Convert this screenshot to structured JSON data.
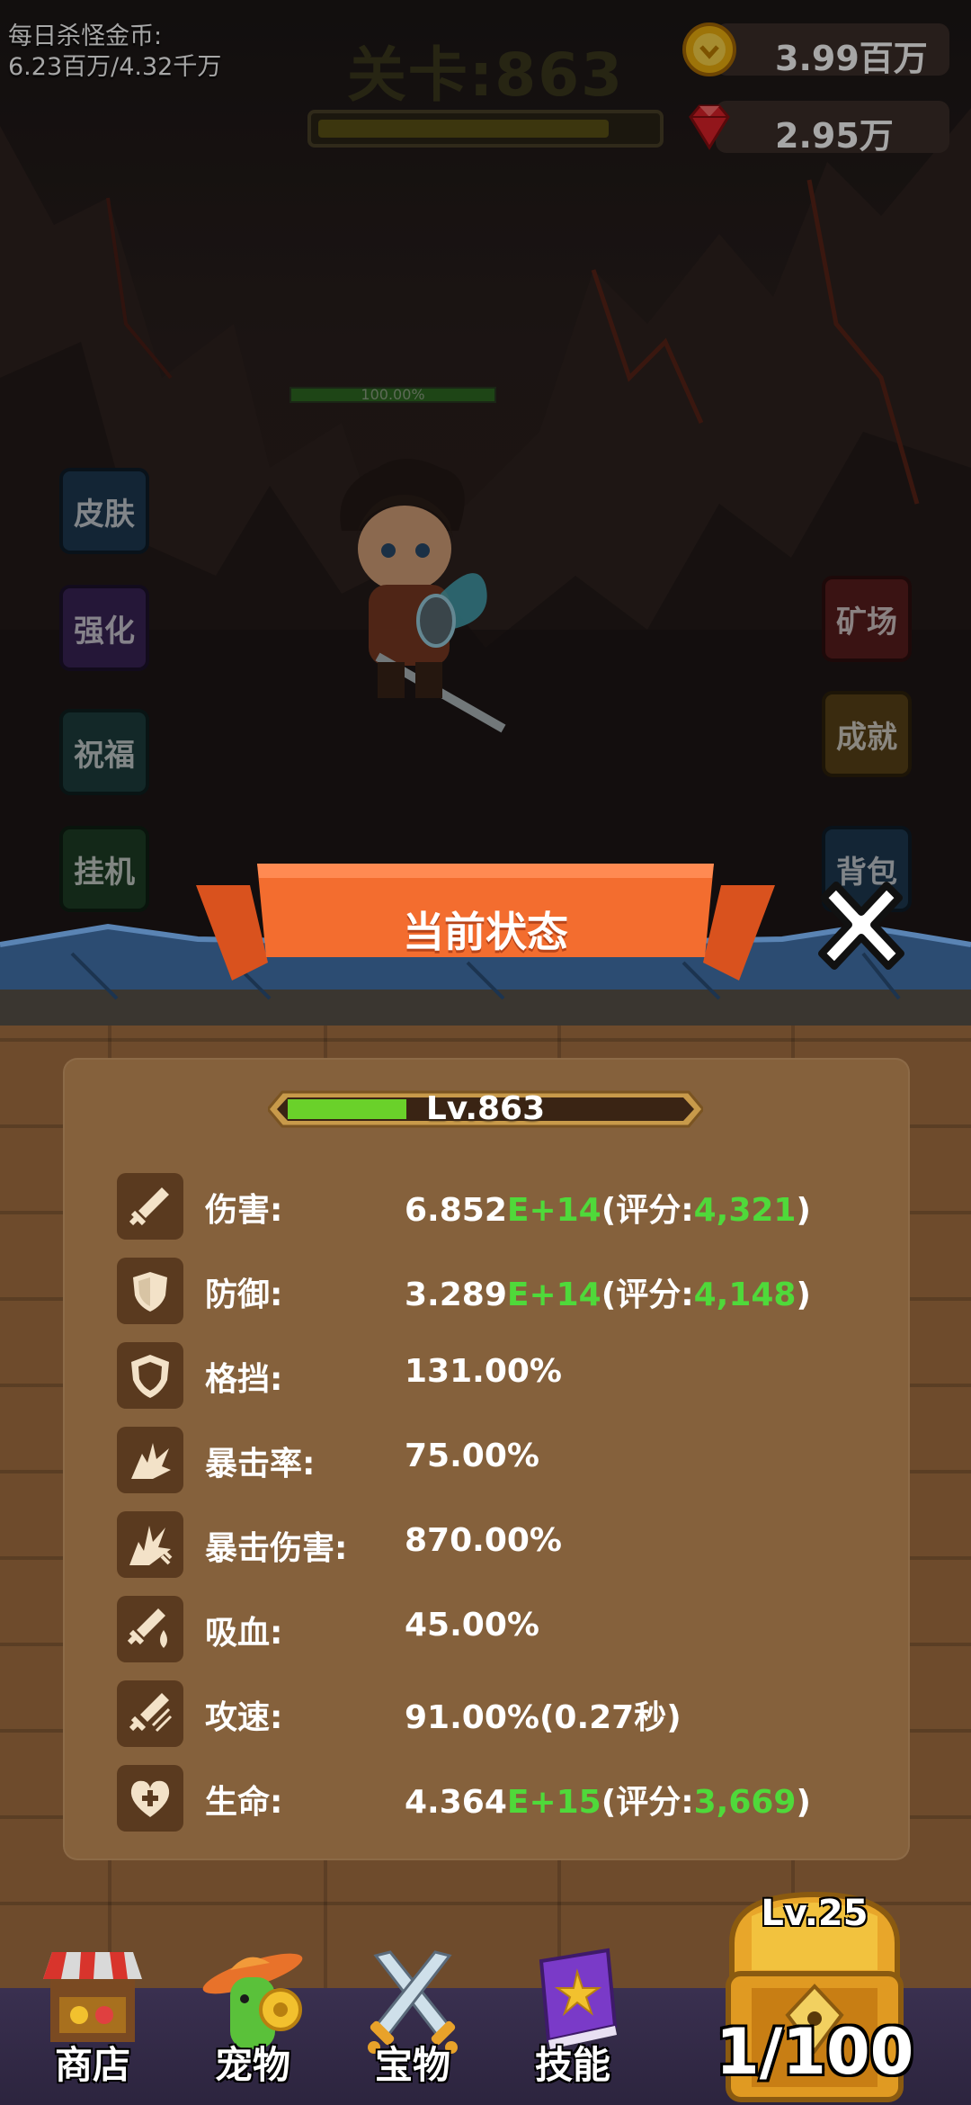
{
  "hud": {
    "daily_label": "每日杀怪金币:",
    "daily_value": "6.23百万/4.32千万",
    "stage_title": "关卡:863",
    "stage_progress": 0.85,
    "gold": "3.99百万",
    "gems": "2.95万",
    "hp_text": "100.00%"
  },
  "side_menu": {
    "left": [
      {
        "label": "皮肤",
        "color": "#1e3a52"
      },
      {
        "label": "强化",
        "color": "#3a2456"
      },
      {
        "label": "祝福",
        "color": "#1e3e3e"
      },
      {
        "label": "挂机",
        "color": "#1e3e26"
      }
    ],
    "right": [
      {
        "label": "矿场",
        "color": "#5a1e1e"
      },
      {
        "label": "成就",
        "color": "#5a4218"
      },
      {
        "label": "背包",
        "color": "#1e3a52"
      }
    ]
  },
  "panel": {
    "title": "当前状态",
    "level_text": "Lv.863",
    "level_progress": 0.3,
    "stats": [
      {
        "icon": "sword-icon",
        "label": "伤害:",
        "base": "6.852",
        "exp": "E+14",
        "pre": "(评分:",
        "score": "4,321",
        "post": ")"
      },
      {
        "icon": "shield-icon",
        "label": "防御:",
        "base": "3.289",
        "exp": "E+14",
        "pre": "(评分:",
        "score": "4,148",
        "post": ")"
      },
      {
        "icon": "block-shield-icon",
        "label": "格挡:",
        "value": "131.00%"
      },
      {
        "icon": "crit-burst-icon",
        "label": "暴击率:",
        "value": "75.00%"
      },
      {
        "icon": "crit-damage-icon",
        "label": "暴击伤害:",
        "value": "870.00%"
      },
      {
        "icon": "lifesteal-icon",
        "label": "吸血:",
        "value": "45.00%"
      },
      {
        "icon": "attack-speed-icon",
        "label": "攻速:",
        "value": "91.00%(0.27秒)"
      },
      {
        "icon": "heart-plus-icon",
        "label": "生命:",
        "base": "4.364",
        "exp": "E+15",
        "pre": "(评分:",
        "score": "3,669",
        "post": ")"
      }
    ]
  },
  "bottom_nav": [
    {
      "icon": "shop-icon",
      "label": "商店"
    },
    {
      "icon": "pet-icon",
      "label": "宠物"
    },
    {
      "icon": "treasure-icon",
      "label": "宝物"
    },
    {
      "icon": "skill-book-icon",
      "label": "技能"
    }
  ],
  "chest": {
    "level": "Lv.25",
    "count": "1/100"
  }
}
